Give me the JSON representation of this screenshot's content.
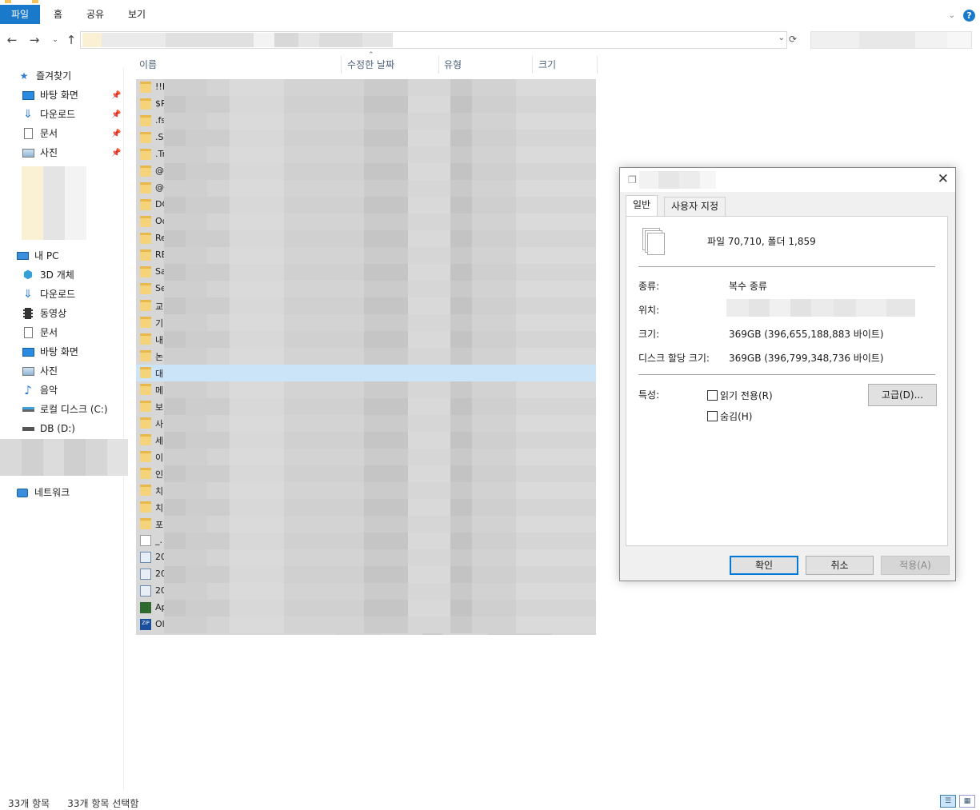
{
  "ribbon": {
    "tabs": [
      "파일",
      "홈",
      "공유",
      "보기"
    ],
    "help": "?"
  },
  "sidebar": {
    "quick_access": "즐겨찾기",
    "quick_items": [
      "바탕 화면",
      "다운로드",
      "문서",
      "사진"
    ],
    "this_pc": "내 PC",
    "pc_items": [
      "3D 개체",
      "다운로드",
      "동영상",
      "문서",
      "바탕 화면",
      "사진",
      "음악",
      "로컬 디스크 (C:)",
      "DB (D:)"
    ],
    "network": "네트워크"
  },
  "columns": {
    "name": "이름",
    "modified": "수정한 날짜",
    "type": "유형",
    "size": "크기"
  },
  "files": [
    {
      "prefix": "!!F",
      "icon": "folder"
    },
    {
      "prefix": "$R",
      "icon": "folder"
    },
    {
      "prefix": ".fs",
      "icon": "folder"
    },
    {
      "prefix": ".S",
      "icon": "folder"
    },
    {
      "prefix": ".Tr",
      "icon": "folder"
    },
    {
      "prefix": "@",
      "icon": "folder"
    },
    {
      "prefix": "@",
      "icon": "folder"
    },
    {
      "prefix": "DC",
      "icon": "folder"
    },
    {
      "prefix": "Oc",
      "icon": "folder"
    },
    {
      "prefix": "Re",
      "icon": "folder"
    },
    {
      "prefix": "RE",
      "icon": "folder"
    },
    {
      "prefix": "Sa",
      "icon": "folder"
    },
    {
      "prefix": "Se",
      "icon": "folder"
    },
    {
      "prefix": "교",
      "icon": "folder"
    },
    {
      "prefix": "기",
      "icon": "folder"
    },
    {
      "prefix": "내",
      "icon": "folder"
    },
    {
      "prefix": "논",
      "icon": "folder"
    },
    {
      "prefix": "대",
      "icon": "folder"
    },
    {
      "prefix": "메",
      "icon": "folder"
    },
    {
      "prefix": "보",
      "icon": "folder"
    },
    {
      "prefix": "사",
      "icon": "folder"
    },
    {
      "prefix": "세",
      "icon": "folder"
    },
    {
      "prefix": "이",
      "icon": "folder"
    },
    {
      "prefix": "인",
      "icon": "folder"
    },
    {
      "prefix": "치",
      "icon": "folder"
    },
    {
      "prefix": "치",
      "icon": "folder"
    },
    {
      "prefix": "포",
      "icon": "folder"
    },
    {
      "prefix": "_.",
      "icon": "document"
    },
    {
      "prefix": "20",
      "icon": "hwp"
    },
    {
      "prefix": "20",
      "icon": "hwp"
    },
    {
      "prefix": "20",
      "icon": "app"
    },
    {
      "prefix": "Ap",
      "icon": "green"
    },
    {
      "prefix": "Ol",
      "icon": "zip"
    }
  ],
  "status": {
    "count": "33개 항목",
    "selected": "33개 항목 선택함"
  },
  "dialog": {
    "tabs": [
      "일반",
      "사용자 지정"
    ],
    "summary": "파일 70,710, 폴더 1,859",
    "props": [
      {
        "label": "종류:",
        "value": "복수 종류"
      },
      {
        "label": "위치:",
        "value": ""
      },
      {
        "label": "크기:",
        "value": "369GB (396,655,188,883 바이트)"
      },
      {
        "label": "디스크 할당 크기:",
        "value": "369GB (396,799,348,736 바이트)"
      }
    ],
    "attributes_label": "특성:",
    "readonly": "읽기 전용(R)",
    "hidden": "숨김(H)",
    "advanced": "고급(D)...",
    "ok": "확인",
    "cancel": "취소",
    "apply": "적용(A)"
  }
}
